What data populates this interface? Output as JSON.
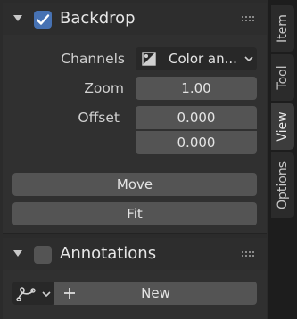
{
  "backdrop": {
    "title": "Backdrop",
    "enabled": true,
    "channels_label": "Channels",
    "channels_value": "Color an...",
    "zoom_label": "Zoom",
    "zoom_value": "1.00",
    "offset_label": "Offset",
    "offset_x": "0.000",
    "offset_y": "0.000",
    "move_label": "Move",
    "fit_label": "Fit"
  },
  "annotations": {
    "title": "Annotations",
    "enabled": false,
    "new_label": "New"
  },
  "tabs": [
    {
      "label": "Item",
      "active": false
    },
    {
      "label": "Tool",
      "active": false
    },
    {
      "label": "View",
      "active": true
    },
    {
      "label": "Options",
      "active": false
    }
  ],
  "colors": {
    "accent": "#4772b3",
    "panel_bg": "#303030",
    "field_bg": "#545454",
    "window_bg": "#1d1d1d"
  }
}
